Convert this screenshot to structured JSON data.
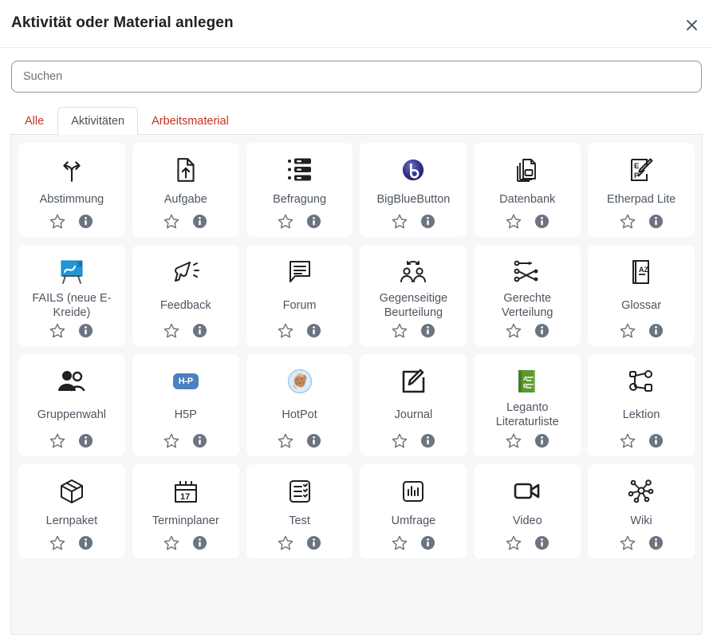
{
  "modal": {
    "title": "Aktivität oder Material anlegen",
    "close_label": "×",
    "close_icon": "close-icon"
  },
  "search": {
    "placeholder": "Suchen",
    "value": ""
  },
  "tabs": [
    {
      "label": "Alle",
      "active": false
    },
    {
      "label": "Aktivitäten",
      "active": true
    },
    {
      "label": "Arbeitsmaterial",
      "active": false
    }
  ],
  "colors": {
    "tab_link": "#ca3120",
    "tab_active_text": "#495057",
    "panel_bg": "#f5f7f9",
    "card_bg": "#ffffff",
    "label_text": "#4d5661",
    "info_badge": "#6b7480",
    "star_outline": "#6c757d",
    "h5p_blue": "#4b81be",
    "bigbluebutton_blue": "#2b2f86",
    "fails_blue": "#31a8e0",
    "leganto_green": "#6aa game"
  },
  "card_actions": {
    "star_label": "star-icon",
    "info_label": "info-icon"
  },
  "cards": [
    {
      "label": "Abstimmung",
      "icon": "signpost-fork-icon"
    },
    {
      "label": "Aufgabe",
      "icon": "file-upload-icon"
    },
    {
      "label": "Befragung",
      "icon": "survey-list-icon"
    },
    {
      "label": "BigBlueButton",
      "icon": "bigbluebutton-logo-icon"
    },
    {
      "label": "Datenbank",
      "icon": "database-pages-icon"
    },
    {
      "label": "Etherpad Lite",
      "icon": "etherpad-pencil-icon"
    },
    {
      "label": "FAILS (neue E-Kreide)",
      "icon": "fails-chalkboard-icon"
    },
    {
      "label": "Feedback",
      "icon": "megaphone-icon"
    },
    {
      "label": "Forum",
      "icon": "speech-bubble-lines-icon"
    },
    {
      "label": "Gegenseitige Beurteilung",
      "icon": "two-people-exchange-icon"
    },
    {
      "label": "Gerechte Verteilung",
      "icon": "distribution-nodes-icon"
    },
    {
      "label": "Glossar",
      "icon": "book-az-icon"
    },
    {
      "label": "Gruppenwahl",
      "icon": "two-users-icon"
    },
    {
      "label": "H5P",
      "icon": "h5p-logo-icon"
    },
    {
      "label": "HotPot",
      "icon": "hotpot-hand-icon"
    },
    {
      "label": "Journal",
      "icon": "square-pencil-icon"
    },
    {
      "label": "Leganto Literaturliste",
      "icon": "leganto-book-icon"
    },
    {
      "label": "Lektion",
      "icon": "lesson-branch-icon"
    },
    {
      "label": "Lernpaket",
      "icon": "package-box-icon"
    },
    {
      "label": "Terminplaner",
      "icon": "calendar-17-icon"
    },
    {
      "label": "Test",
      "icon": "quiz-checklist-icon"
    },
    {
      "label": "Umfrage",
      "icon": "bar-chart-box-icon"
    },
    {
      "label": "Video",
      "icon": "video-camera-icon"
    },
    {
      "label": "Wiki",
      "icon": "network-hub-icon"
    }
  ]
}
